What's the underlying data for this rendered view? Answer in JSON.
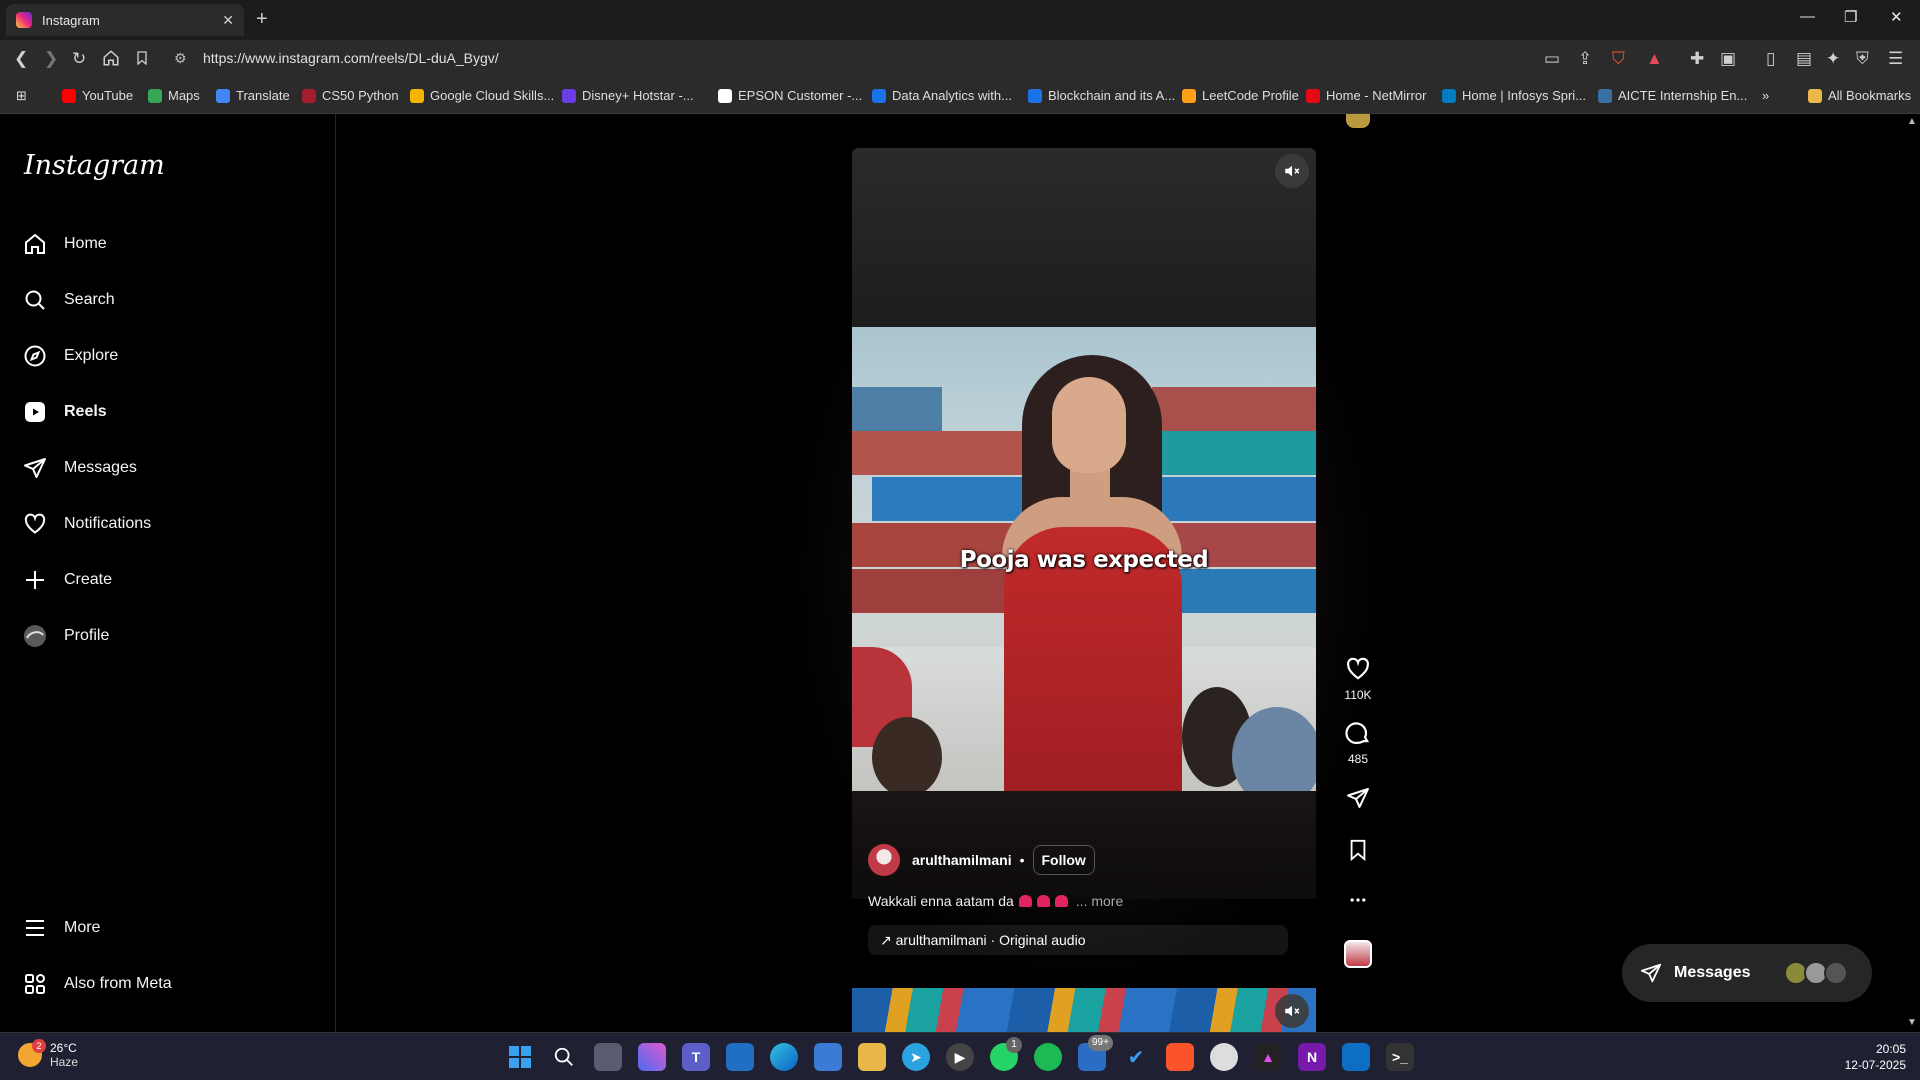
{
  "browser": {
    "tab_title": "Instagram",
    "tab_close": "✕",
    "new_tab": "+",
    "url": "https://www.instagram.com/reels/DL-duA_Bygv/",
    "window_controls": [
      "—",
      "❐",
      "✕"
    ],
    "bookmarks": [
      {
        "label": "YouTube",
        "color": "#ff0000"
      },
      {
        "label": "Maps",
        "color": "#34a853"
      },
      {
        "label": "Translate",
        "color": "#4285f4"
      },
      {
        "label": "CS50 Python",
        "color": "#a51c30"
      },
      {
        "label": "Google Cloud Skills...",
        "color": "#f4b400"
      },
      {
        "label": "Disney+ Hotstar -...",
        "color": "#6a3de8"
      },
      {
        "label": "EPSON Customer -...",
        "color": "#ffffff"
      },
      {
        "label": "Data Analytics with...",
        "color": "#1a73e8"
      },
      {
        "label": "Blockchain and its A...",
        "color": "#1a73e8"
      },
      {
        "label": "LeetCode Profile",
        "color": "#ffa116"
      },
      {
        "label": "Home - NetMirror",
        "color": "#e50914"
      },
      {
        "label": "Home | Infosys Spri...",
        "color": "#007cc3"
      },
      {
        "label": "AICTE Internship En...",
        "color": "#3a6ea5"
      }
    ],
    "overflow": "»",
    "all_bookmarks": "All Bookmarks"
  },
  "sidebar": {
    "logo": "Instagram",
    "items": [
      {
        "label": "Home",
        "icon": "home-icon"
      },
      {
        "label": "Search",
        "icon": "search-icon"
      },
      {
        "label": "Explore",
        "icon": "compass-icon"
      },
      {
        "label": "Reels",
        "icon": "reels-icon"
      },
      {
        "label": "Messages",
        "icon": "send-icon"
      },
      {
        "label": "Notifications",
        "icon": "heart-icon"
      },
      {
        "label": "Create",
        "icon": "plus-icon"
      },
      {
        "label": "Profile",
        "icon": "avatar-icon"
      }
    ],
    "bottom_items": [
      {
        "label": "More",
        "icon": "menu-icon"
      },
      {
        "label": "Also from Meta",
        "icon": "meta-grid-icon"
      }
    ]
  },
  "reel": {
    "overlay_text": "Pooja was expected",
    "username": "arulthamilmani",
    "separator": "•",
    "follow_label": "Follow",
    "caption": "Wakkali enna aatam da",
    "caption_more": "... more",
    "audio": "↗ arulthamilmani · Original audio",
    "likes": "110K",
    "comments": "485"
  },
  "messages_pill": {
    "label": "Messages"
  },
  "taskbar": {
    "weather_temp": "26°C",
    "weather_desc": "Haze",
    "weather_badge": "2",
    "notif_badge": "99+",
    "whatsapp_badge": "1",
    "time": "20:05",
    "date": "12-07-2025"
  },
  "colors": {
    "accent": "#0095f6",
    "dress_red": "#c12a2a",
    "taskbar": "#202033"
  }
}
